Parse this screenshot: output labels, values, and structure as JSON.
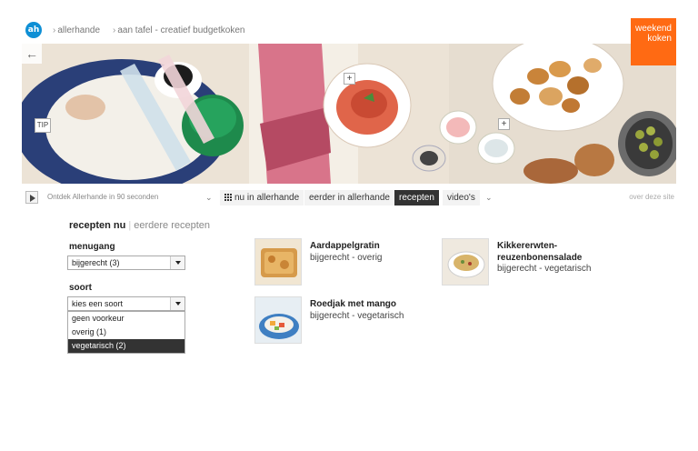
{
  "breadcrumb": {
    "logo": "ah",
    "items": [
      "allerhande",
      "aan tafel - creatief budgetkoken"
    ]
  },
  "weekend_button": {
    "line1": "weekend",
    "line2": "koken"
  },
  "hero": {
    "back_icon": "arrow-left-icon",
    "tip_label": "TIP",
    "plus_label": "+"
  },
  "nav": {
    "ontdek": "Ontdek Allerhande in 90 seconden",
    "tabs": [
      {
        "label": "nu in allerhande",
        "active": false
      },
      {
        "label": "eerder in allerhande",
        "active": false
      },
      {
        "label": "recepten",
        "active": true
      },
      {
        "label": "video's",
        "active": false
      }
    ],
    "about": "over deze site"
  },
  "filters": {
    "tab_current": "recepten nu",
    "tab_other": "eerdere recepten",
    "menugang_label": "menugang",
    "menugang_value": "bijgerecht (3)",
    "soort_label": "soort",
    "soort_value": "kies een soort",
    "soort_options": [
      {
        "label": "geen voorkeur",
        "highlighted": false
      },
      {
        "label": "overig (1)",
        "highlighted": false
      },
      {
        "label": "vegetarisch (2)",
        "highlighted": true
      }
    ]
  },
  "recipes": [
    {
      "title": "Aardappelgratin",
      "subtitle": "bijgerecht - overig"
    },
    {
      "title": "Kikkererwten-reuzenbonensalade",
      "subtitle": "bijgerecht - vegetarisch"
    },
    {
      "title": "Roedjak met mango",
      "subtitle": "bijgerecht - vegetarisch"
    }
  ],
  "colors": {
    "accent": "#ff6a13",
    "brand": "#0e8fd5",
    "active_tab": "#333333"
  }
}
